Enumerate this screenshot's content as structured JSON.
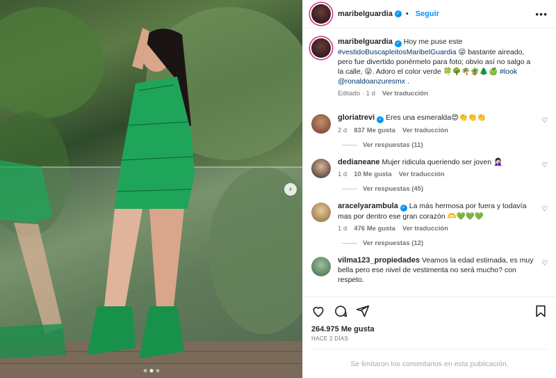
{
  "post": {
    "author": "maribelguardia",
    "follow_label": "Seguir",
    "more_label": "•••",
    "caption_parts": {
      "lead": "Hoy me puse este",
      "hashtag1": "#vestidoBuscapleitosMaribelGuardia",
      "mid": "😜 bastante aireado, pero fue divertido ponérmelo para foto; obvio así no salgo a la calle, 😜. Adoro el color verde 🍀🌳🌴🪴🌲🍏",
      "hashtag2": "#look",
      "mention": "@ronaldoanzuresmx",
      "tail": "."
    },
    "caption_meta": {
      "edited": "Editado · 1 d",
      "translate": "Ver traducción"
    }
  },
  "comments": [
    {
      "user": "gloriatrevi",
      "verified": true,
      "text": "Eres una esmeralda😍👏👏👏",
      "age": "2 d",
      "likes": "837 Me gusta",
      "translate": "Ver traducción",
      "replies": "Ver respuestas (11)"
    },
    {
      "user": "dedianeane",
      "verified": false,
      "text": "Mujer ridicula queriendo ser joven 🤦🏻‍♀️",
      "age": "1 d",
      "likes": "10 Me gusta",
      "translate": "Ver traducción",
      "replies": "Ver respuestas (45)"
    },
    {
      "user": "aracelyarambula",
      "verified": true,
      "text": "La más hermosa por fuera y todavía mas por dentro ese gran corazón 🫶💚💚💚",
      "age": "1 d",
      "likes": "476 Me gusta",
      "translate": "Ver traducción",
      "replies": "Ver respuestas (12)"
    },
    {
      "user": "vilma123_propiedades",
      "verified": false,
      "text": "Veamos la edad estimada, es muy bella pero ese nivel de vestimenta no será mucho? con respeto.",
      "age": "",
      "likes": "",
      "translate": "",
      "replies": ""
    }
  ],
  "footer": {
    "likes": "264.975 Me gusta",
    "date": "HACE 2 DÍAS",
    "limited": "Se limitaron los comentarios en esta publicación."
  },
  "icons": {
    "like": "heart-icon",
    "comment": "comment-icon",
    "share": "share-icon",
    "save": "bookmark-icon",
    "next": "chevron-right-icon"
  },
  "colors": {
    "accent": "#0095f6",
    "link": "#00376b",
    "muted": "#737373",
    "dress": "#1fa55a"
  }
}
